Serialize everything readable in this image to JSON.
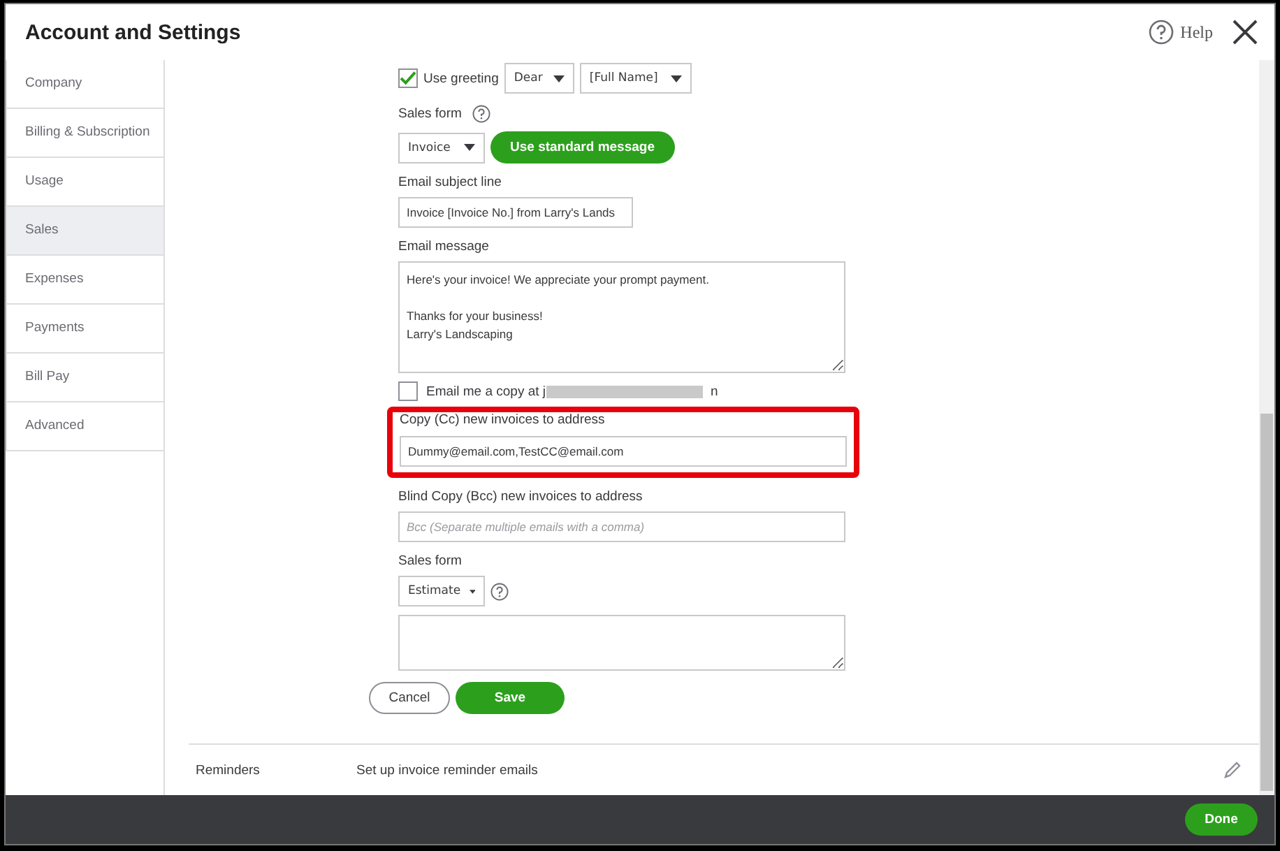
{
  "window": {
    "title": "Account and Settings",
    "help": "Help"
  },
  "sidebar": {
    "items": [
      {
        "label": "Company",
        "selected": false
      },
      {
        "label": "Billing & Subscription",
        "selected": false
      },
      {
        "label": "Usage",
        "selected": false
      },
      {
        "label": "Sales",
        "selected": true
      },
      {
        "label": "Expenses",
        "selected": false
      },
      {
        "label": "Payments",
        "selected": false
      },
      {
        "label": "Bill Pay",
        "selected": false
      },
      {
        "label": "Advanced",
        "selected": false
      }
    ]
  },
  "messages": {
    "greeting": {
      "checked": true,
      "label": "Use greeting",
      "salutation": "Dear",
      "name_format": "[Full Name]"
    },
    "sales_form": {
      "label": "Sales form",
      "value": "Invoice"
    },
    "standard_button": "Use standard message",
    "subject": {
      "label": "Email subject line",
      "value": "Invoice [Invoice No.] from Larry's Lands"
    },
    "message": {
      "label": "Email message",
      "paragraphs": [
        "Here's your invoice! We appreciate your prompt payment.",
        "Thanks for your business!\nLarry's Landscaping"
      ]
    },
    "email_copy": {
      "checked": false,
      "label": "Email me a copy at j",
      "tail": "n"
    },
    "cc": {
      "label": "Copy (Cc) new invoices to address",
      "value": "Dummy@email.com,TestCC@email.com",
      "highlighted": true
    },
    "bcc": {
      "label": "Blind Copy (Bcc) new invoices to address",
      "placeholder": "Bcc (Separate multiple emails with a comma)"
    },
    "sales_form_2": {
      "label": "Sales form",
      "value": "Estimate"
    },
    "buttons": {
      "cancel": "Cancel",
      "save": "Save"
    }
  },
  "reminders": {
    "label": "Reminders",
    "description": "Set up invoice reminder emails"
  },
  "footer": {
    "done": "Done"
  }
}
